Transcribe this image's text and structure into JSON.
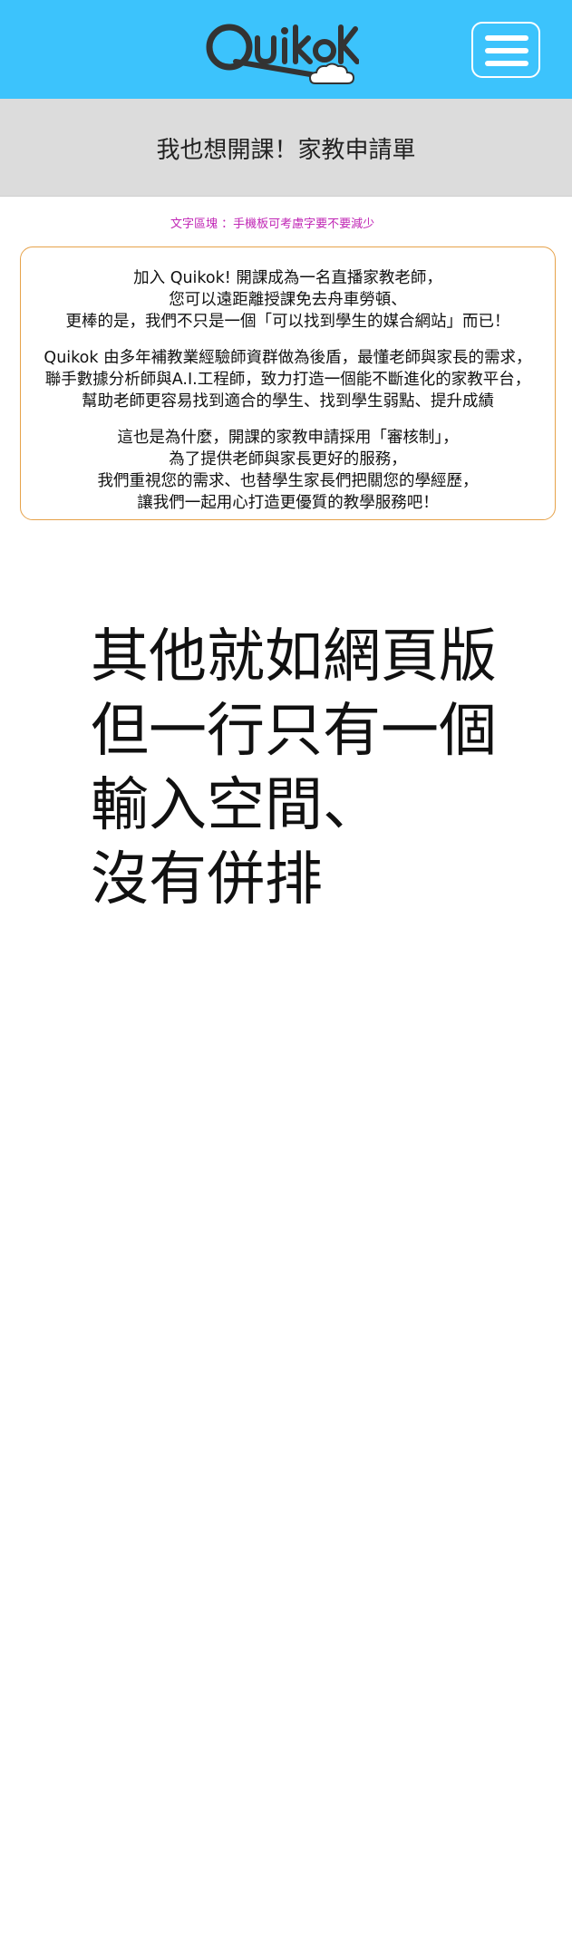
{
  "header": {
    "logo_text": "Quikok",
    "menu_button_label": "Menu"
  },
  "banner": {
    "title": "我也想開課！家教申請單"
  },
  "note": "文字區塊 ：手機板可考慮字要不要減少",
  "intro": {
    "paragraph1": [
      "加入 Quikok! 開課成為一名直播家教老師，",
      "您可以遠距離授課免去舟車勞頓、",
      "更棒的是，我們不只是一個「可以找到學生的媒合網站」而已！"
    ],
    "paragraph2": [
      "Quikok 由多年補教業經驗師資群做為後盾，最懂老師與家長的需求，",
      "聯手數據分析師與A.I.工程師，致力打造一個能不斷進化的家教平台，",
      "幫助老師更容易找到適合的學生、找到學生弱點、提升成績"
    ],
    "paragraph3": [
      "這也是為什麼，開課的家教申請採用「審核制」，",
      "為了提供老師與家長更好的服務，",
      "我們重視您的需求、也替學生家長們把關您的學經歷，",
      "讓我們一起用心打造更優質的教學服務吧！"
    ]
  },
  "annotation": [
    "其他就如網頁版",
    "但一行只有一個",
    "輸入空間、",
    "沒有併排"
  ],
  "colors": {
    "header_bg": "#3cc3fc",
    "banner_bg": "#dcdcdc",
    "note_text": "#c026b5",
    "box_border": "#e6a24a"
  },
  "icons": {
    "logo": "quikok-logo",
    "menu": "hamburger-menu-icon"
  }
}
